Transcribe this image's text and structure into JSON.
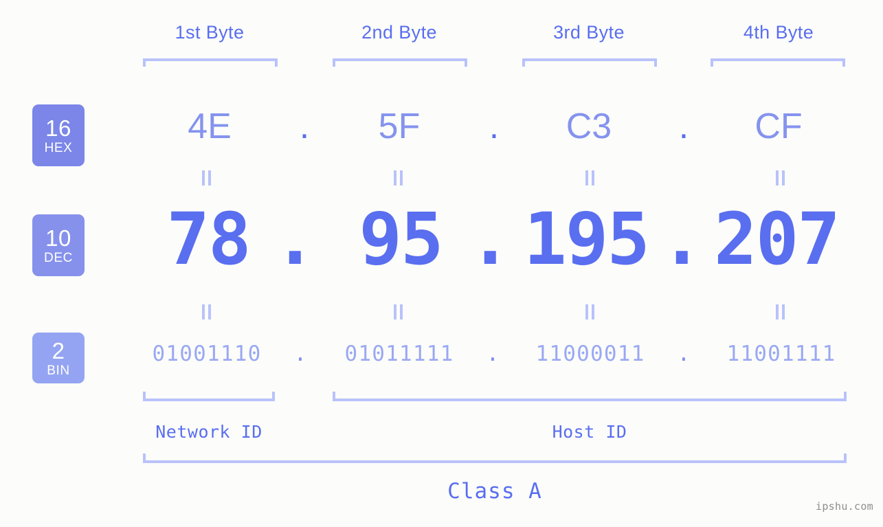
{
  "meta": {
    "watermark": "ipshu.com",
    "background_color": "#fcfdfa",
    "accent_color": "#5a6ef0",
    "accent_light_color": "#b9c2fb"
  },
  "byte_headers": [
    {
      "label": "1st Byte"
    },
    {
      "label": "2nd Byte"
    },
    {
      "label": "3rd Byte"
    },
    {
      "label": "4th Byte"
    }
  ],
  "bases": [
    {
      "number": "16",
      "name": "HEX",
      "color": "#7b86e8"
    },
    {
      "number": "10",
      "name": "DEC",
      "color": "#8691ec"
    },
    {
      "number": "2",
      "name": "BIN",
      "color": "#94a4f2"
    }
  ],
  "rows": {
    "hex": {
      "values": [
        "4E",
        "5F",
        "C3",
        "CF"
      ],
      "separator": "."
    },
    "dec": {
      "values": [
        "78",
        "95",
        "195",
        "207"
      ],
      "separator": "."
    },
    "bin": {
      "values": [
        "01001110",
        "01011111",
        "11000011",
        "11001111"
      ],
      "separator": "."
    }
  },
  "equals_symbol": "=",
  "sections": [
    {
      "label": "Network ID"
    },
    {
      "label": "Host ID"
    }
  ],
  "class": {
    "label": "Class A"
  }
}
